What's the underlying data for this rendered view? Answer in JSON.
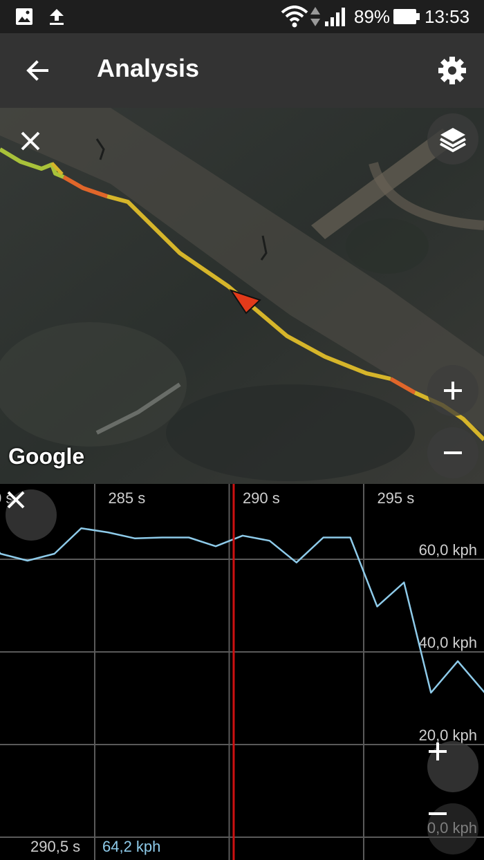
{
  "status_bar": {
    "battery": "89%",
    "time": "13:53",
    "icons": [
      "image-icon",
      "upload-icon",
      "wifi-icon",
      "data-arrows-icon",
      "signal-icon",
      "battery-icon"
    ]
  },
  "app_bar": {
    "title": "Analysis",
    "back_icon": "arrow-left-icon",
    "settings_icon": "gear-icon"
  },
  "map": {
    "attribution": "Google",
    "buttons": [
      "close-icon",
      "layers-icon",
      "zoom-in-icon",
      "zoom-out-icon"
    ],
    "track_colors": {
      "normal": "#d6b52a",
      "fast": "#e0662a",
      "slow": "#a9c23a"
    },
    "marker_color": "#e23a1a"
  },
  "chart_data": {
    "type": "line",
    "title": "",
    "xlabel": "",
    "ylabel": "",
    "x_ticks": [
      "0 s",
      "285 s",
      "290 s",
      "295 s"
    ],
    "y_ticks": [
      "0,0 kph",
      "20,0 kph",
      "40,0 kph",
      "60,0 kph"
    ],
    "xlim": [
      280.8,
      299.8
    ],
    "ylim": [
      0,
      70.3
    ],
    "grid": true,
    "series": [
      {
        "color": "#8ecbea",
        "x": [
          279.5,
          280.5,
          281.5,
          282.5,
          283.5,
          284.5,
          285.5,
          286.5,
          287.5,
          288.5,
          289.5,
          290.5,
          291.5,
          292.5,
          293.5,
          294.5,
          295.5,
          296.5,
          297.5,
          298.5,
          299.5,
          299.8
        ],
        "y": [
          68.5,
          68.2,
          61.2,
          59.7,
          61.2,
          66.7,
          65.8,
          64.5,
          64.7,
          64.7,
          62.8,
          65.1,
          64.0,
          59.3,
          64.7,
          64.7,
          49.8,
          55.0,
          31.2,
          38.0,
          31.2,
          30.5
        ]
      }
    ],
    "cursor": {
      "x": 290.5,
      "color": "#cc1111"
    },
    "readout": {
      "time": "290,5 s",
      "value": "64,2 kph"
    }
  },
  "chart_buttons": [
    "close-icon",
    "zoom-in-icon",
    "zoom-out-icon"
  ]
}
